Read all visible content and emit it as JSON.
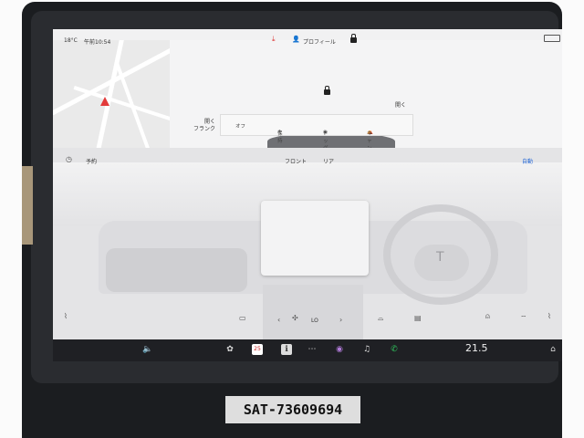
{
  "status_bar": {
    "temperature": "18°C",
    "time": "午前10:54",
    "profile_label": "プロフィール"
  },
  "vehicle": {
    "left_label": "開く\nフランク",
    "right_label": "開く",
    "modes": [
      "オフ",
      "保持",
      "ドッグ",
      "キャンプ"
    ]
  },
  "climate": {
    "schedule_label": "予約",
    "tabs": [
      "フロント",
      "リア"
    ],
    "auto_label": "自動",
    "fan_level": "LO"
  },
  "taskbar": {
    "cabin_temp": "21.5",
    "calendar_day": "25"
  },
  "watermark": "SAT-73609694",
  "colors": {
    "accent_blue": "#2a6bd6",
    "nav_red": "#e23a3a",
    "phone_green": "#2fc05c"
  }
}
